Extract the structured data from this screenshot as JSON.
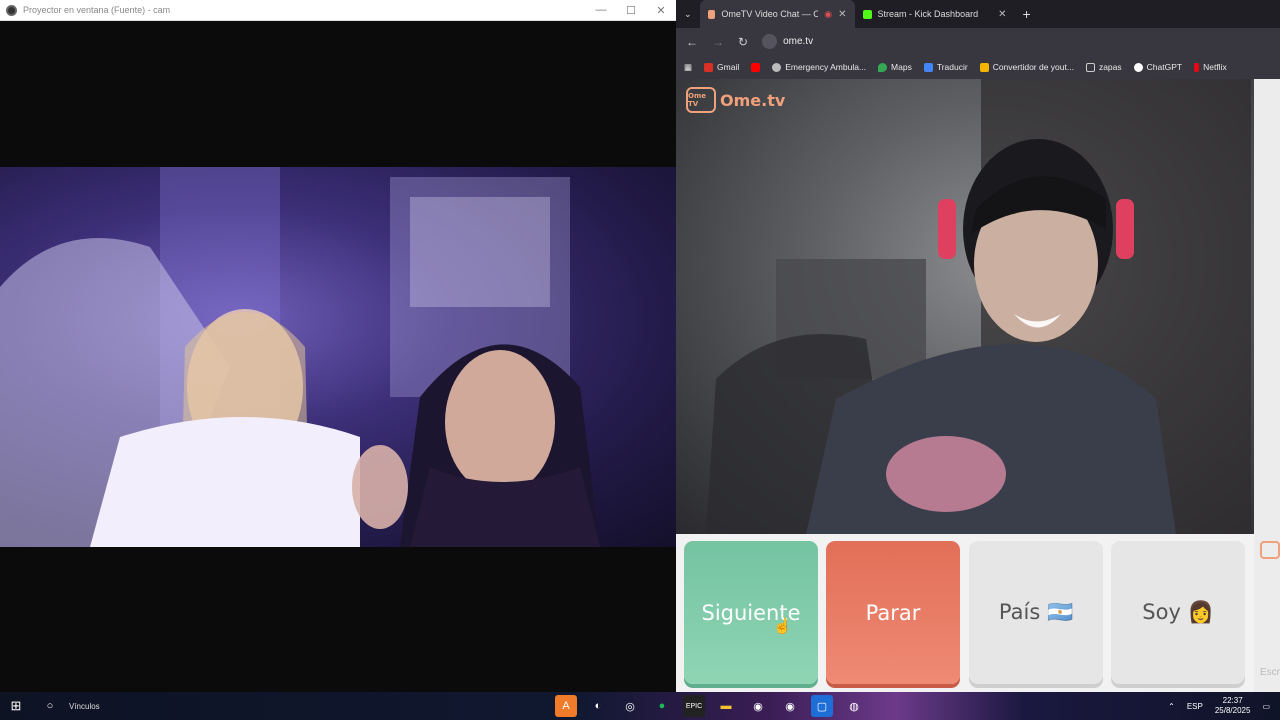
{
  "projector": {
    "title": "Proyector en ventana (Fuente) - cam",
    "controls": {
      "minimize": "—",
      "maximize": "☐",
      "close": "✕"
    }
  },
  "browser": {
    "tabs": [
      {
        "label": "OmeTV Video Chat — Ome",
        "active": true
      },
      {
        "label": "Stream - Kick Dashboard",
        "active": false
      }
    ],
    "new_tab": "+",
    "url": "ome.tv",
    "bookmarks": [
      {
        "label": "Gmail",
        "color": "#d93025"
      },
      {
        "label": "",
        "color": "#ff0000"
      },
      {
        "label": "Emergency Ambula...",
        "color": "#bbbbbb"
      },
      {
        "label": "Maps",
        "color": "#34a853"
      },
      {
        "label": "Traducir",
        "color": "#4285f4"
      },
      {
        "label": "Convertidor de yout...",
        "color": "#f4b400"
      },
      {
        "label": "zapas",
        "color": "#cccccc"
      },
      {
        "label": "ChatGPT",
        "color": "#ffffff"
      },
      {
        "label": "Netflix",
        "color": "#e50914"
      }
    ]
  },
  "ome": {
    "logo_text": "Ome.tv",
    "logo_badge": "Ome TV",
    "buttons": {
      "next": "Siguiente",
      "stop": "Parar",
      "country": "País 🇦🇷",
      "gender": "Soy 👩"
    },
    "side_hint": "Escr"
  },
  "taskbar": {
    "search_label": "Vínculos",
    "language": "ESP",
    "time": "22:37",
    "date": "25/8/2025"
  }
}
